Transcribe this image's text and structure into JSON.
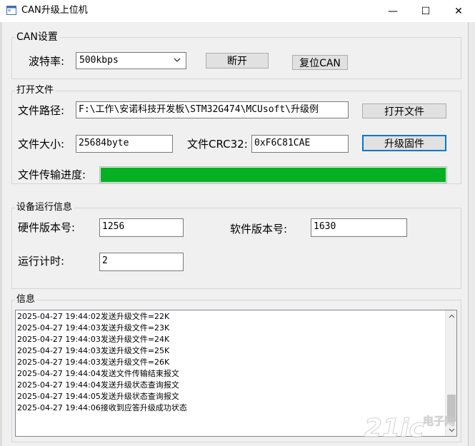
{
  "window": {
    "title": "CAN升级上位机",
    "minimize_glyph": "—",
    "maximize_glyph": "☐",
    "close_glyph": "✕",
    "icon": "app-window-icon"
  },
  "can_settings": {
    "title": "CAN设置",
    "baud_label": "波特率:",
    "baud_value": "500kbps",
    "disconnect_label": "断开",
    "reset_label": "复位CAN"
  },
  "open_file": {
    "title": "打开文件",
    "path_label": "文件路径:",
    "path_value": "F:\\工作\\安诺科技开发板\\STM32G474\\MCUsoft\\升级例",
    "open_button": "打开文件",
    "size_label": "文件大小:",
    "size_value": "25684byte",
    "crc_label": "文件CRC32:",
    "crc_value": "0xF6C81CAE",
    "upgrade_button": "升级固件",
    "progress_label": "文件传输进度:",
    "progress_value": 1.0,
    "progress_color": "#06b025"
  },
  "device_info": {
    "title": "设备运行信息",
    "hw_label": "硬件版本号:",
    "hw_value": "1256",
    "sw_label": "软件版本号:",
    "sw_value": "1630",
    "runtime_label": "运行计时:",
    "runtime_value": "2"
  },
  "info": {
    "title": "信息",
    "lines": [
      "2025-04-27 19:44:02发送升级文件=22K",
      "2025-04-27 19:44:03发送升级文件=23K",
      "2025-04-27 19:44:03发送升级文件=24K",
      "2025-04-27 19:44:03发送升级文件=25K",
      "2025-04-27 19:44:03发送升级文件=26K",
      "2025-04-27 19:44:04发送文件传输结束报文",
      "2025-04-27 19:44:04发送升级状态查询报文",
      "2025-04-27 19:44:05发送升级状态查询报文",
      "2025-04-27 19:44:06接收到应答升级成功状态"
    ]
  },
  "watermark": {
    "brand": "21ic",
    "text": "电子网"
  }
}
